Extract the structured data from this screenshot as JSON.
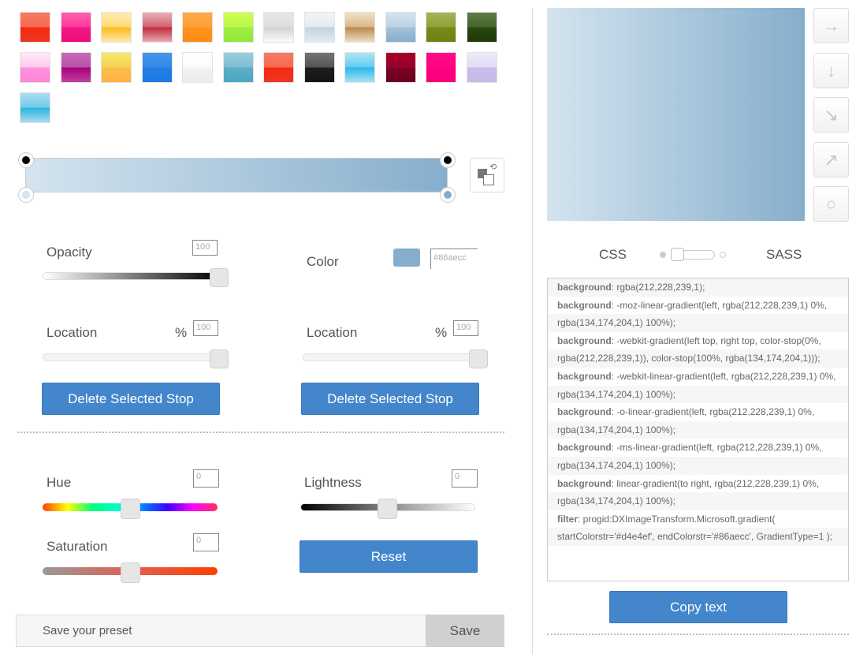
{
  "presets": [
    [
      "#f77a62",
      "#f76a55",
      "#f52a12",
      "#ee3520"
    ],
    [
      "#ff60b0",
      "#ff3a98",
      "#f51888",
      "#ee0a7a"
    ],
    [
      "#ffeab0",
      "#ffdc78",
      "#fcbc18",
      "#ffe8a8"
    ],
    [
      "#eab0b8",
      "#d06070",
      "#c02a3e",
      "#eaa8b2"
    ],
    [
      "#ffaa48",
      "#ffa038",
      "#ff9420",
      "#ff8a10"
    ],
    [
      "#ccff50",
      "#bcf848",
      "#a2ee40",
      "#8ee83a"
    ],
    [
      "#e6e6e6",
      "#dedede",
      "#d2d2d2",
      "#fbfbfb"
    ],
    [
      "#f0f4f7",
      "#e4ebf0",
      "#c2d2dc",
      "#e0ecf2"
    ],
    [
      "#f2e0c4",
      "#d8b888",
      "#b88a4a",
      "#eedcc2"
    ],
    [
      "#d4e4ef",
      "#bcd2e4",
      "#a4c2da",
      "#86aecc"
    ],
    [
      "#a4b458",
      "#90a038",
      "#788a18",
      "#6e8010"
    ],
    [
      "#5e7e44",
      "#46642c",
      "#2a4612",
      "#1e3808"
    ],
    [
      "#ffeaf8",
      "#ffc8ec",
      "#ff90dc",
      "#ff84d6"
    ],
    [
      "#c868b8",
      "#b850a6",
      "#a8007a",
      "#c040a0"
    ],
    [
      "#f4ea6a",
      "#f8d058",
      "#fcc04c",
      "#ffb040"
    ],
    [
      "#4494ea",
      "#3488e6",
      "#2480e2",
      "#1a78e0"
    ],
    [
      "#ffffff",
      "#fbfbfb",
      "#f2f2f2",
      "#ececec"
    ],
    [
      "#94d0de",
      "#7ebed2",
      "#5eaec8",
      "#4aa6c0"
    ],
    [
      "#f77a62",
      "#f76a55",
      "#f52a12",
      "#ee3520"
    ],
    [
      "#747474",
      "#555555",
      "#1e1e1e",
      "#141414"
    ],
    [
      "#b0e4f6",
      "#60ccee",
      "#2ab8e8",
      "#a8e0f4"
    ],
    [
      "#a80028",
      "#98002a",
      "#7e0024",
      "#6a0020"
    ],
    [
      "#ff0a88",
      "#ff0584",
      "#ff0080",
      "#f8007c"
    ],
    [
      "#eee8fa",
      "#e2dcf4",
      "#c8bcec",
      "#c4baea"
    ],
    [
      "#aadef2",
      "#70cceb",
      "#2ab4e0",
      "#a8dcf0"
    ]
  ],
  "gradient": {
    "start": "#d4e4ef",
    "end": "#86aecc"
  },
  "stop_editor": {
    "opacity_label": "Opacity",
    "opacity_value": "100",
    "opacity_level": 100,
    "color_label": "Color",
    "color_value": "#86aecc",
    "location_label": "Location",
    "percent_sign": "%",
    "left_location_value": "100",
    "right_location_value": "100",
    "location_level": 100,
    "delete_label": "Delete Selected Stop"
  },
  "adjust": {
    "hue_label": "Hue",
    "hue_value": "0",
    "saturation_label": "Saturation",
    "saturation_value": "0",
    "lightness_label": "Lightness",
    "lightness_value": "0",
    "reset_label": "Reset"
  },
  "preset_save": {
    "placeholder": "Save your preset",
    "save_label": "Save"
  },
  "directions": [
    "→",
    "↓",
    "↘",
    "↗",
    "○"
  ],
  "format_toggle": {
    "left": "CSS",
    "right": "SASS",
    "selected": "CSS"
  },
  "code_lines": [
    {
      "prop": "background",
      "val": ": rgba(212,228,239,1);"
    },
    {
      "prop": "background",
      "val": ": -moz-linear-gradient(left, rgba(212,228,239,1) 0%,"
    },
    {
      "prop": "",
      "val": "rgba(134,174,204,1) 100%);"
    },
    {
      "prop": "background",
      "val": ": -webkit-gradient(left top, right top, color-stop(0%,"
    },
    {
      "prop": "",
      "val": "rgba(212,228,239,1)), color-stop(100%, rgba(134,174,204,1)));"
    },
    {
      "prop": "background",
      "val": ": -webkit-linear-gradient(left, rgba(212,228,239,1) 0%,"
    },
    {
      "prop": "",
      "val": "rgba(134,174,204,1) 100%);"
    },
    {
      "prop": "background",
      "val": ": -o-linear-gradient(left, rgba(212,228,239,1) 0%,"
    },
    {
      "prop": "",
      "val": "rgba(134,174,204,1) 100%);"
    },
    {
      "prop": "background",
      "val": ": -ms-linear-gradient(left, rgba(212,228,239,1) 0%,"
    },
    {
      "prop": "",
      "val": "rgba(134,174,204,1) 100%);"
    },
    {
      "prop": "background",
      "val": ": linear-gradient(to right, rgba(212,228,239,1) 0%,"
    },
    {
      "prop": "",
      "val": "rgba(134,174,204,1) 100%);"
    },
    {
      "prop": "filter",
      "val": ": progid:DXImageTransform.Microsoft.gradient("
    },
    {
      "prop": "",
      "val": "startColorstr='#d4e4ef', endColorstr='#86aecc', GradientType=1 );"
    },
    {
      "prop": "",
      "val": ""
    }
  ],
  "copy_label": "Copy text",
  "accent": "#4386cc"
}
